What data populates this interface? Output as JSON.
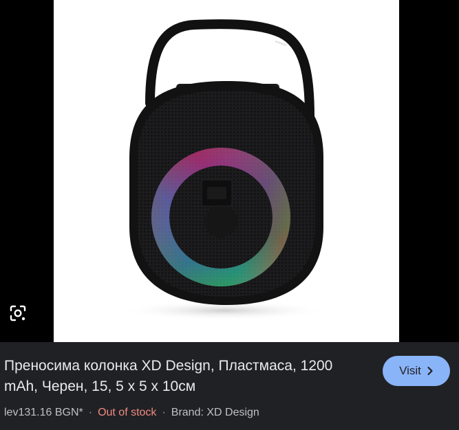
{
  "image": {
    "alt_icon": "google-lens-icon"
  },
  "result": {
    "title": "Преносима колонка XD Design, Пластмаса, 1200 mAh, Черен, 15, 5 x 5 x 10см",
    "visit_label": "Visit",
    "visit_icon": "chevron-right-icon",
    "price": "lev131.16 BGN*",
    "separator": "·",
    "stock_status": "Out of stock",
    "brand": "Brand: XD Design"
  },
  "colors": {
    "panel_bg": "#202124",
    "title_text": "#e8eaed",
    "meta_text": "#bdc1c6",
    "out_of_stock": "#f28b82",
    "visit_bg": "#8ab4f8"
  }
}
